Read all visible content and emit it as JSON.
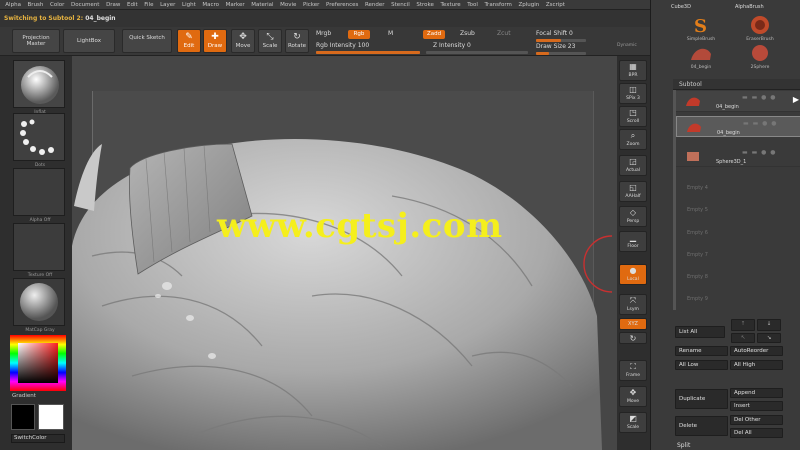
{
  "menu": [
    "Alpha",
    "Brush",
    "Color",
    "Document",
    "Draw",
    "Edit",
    "File",
    "Layer",
    "Light",
    "Macro",
    "Marker",
    "Material",
    "Movie",
    "Picker",
    "Preferences",
    "Render",
    "Stencil",
    "Stroke",
    "Texture",
    "Tool",
    "Transform",
    "Zplugin",
    "Zscript"
  ],
  "status": {
    "prefix": "Switching to Subtool 2:",
    "name": "04_begin"
  },
  "toolbar": {
    "projection_master": "Projection Master",
    "lightbox": "LightBox",
    "quick_sketch": "Quick Sketch",
    "edit": "Edit",
    "draw": "Draw",
    "move": "Move",
    "scale": "Scale",
    "rotate": "Rotate",
    "mrgb": "Mrgb",
    "rgb": "Rgb",
    "m": "M",
    "zadd": "Zadd",
    "zsub": "Zsub",
    "zcut": "Zcut",
    "rgb_intensity": "Rgb Intensity 100",
    "rgb_intensity_value": 1.0,
    "z_intensity": "Z Intensity 0",
    "z_intensity_value": 0.0,
    "focal_shift": "Focal Shift 0",
    "focal_shift_value": 0.5,
    "draw_size": "Draw Size 23",
    "draw_size_value": 0.25,
    "dynamic": "Dynamic"
  },
  "left": {
    "brush_label": "Inflat",
    "stroke_label": "Dots",
    "alpha_label": "Alpha Off",
    "texture_label": "Texture Off",
    "material_label": "MatCap Gray",
    "gradient_label": "Gradient",
    "switch_color": "SwitchColor"
  },
  "canvas": {
    "watermark": "www.cgtsj.com"
  },
  "right": [
    {
      "icon": "▦",
      "label": "BPR"
    },
    {
      "icon": "◫",
      "label": "SPix 3"
    },
    {
      "icon": "◳",
      "label": "Scroll"
    },
    {
      "icon": "⌕",
      "label": "Zoom"
    },
    {
      "icon": "◲",
      "label": "Actual"
    },
    {
      "icon": "◱",
      "label": "AAHalf"
    },
    {
      "icon": "◇",
      "label": "Persp"
    },
    {
      "icon": "▁",
      "label": "Floor"
    },
    {
      "icon": "●",
      "label": "Local"
    },
    {
      "icon": "⤧",
      "label": "Lsym"
    },
    {
      "icon": "XYZ",
      "label": ""
    },
    {
      "icon": "↻",
      "label": ""
    },
    {
      "icon": "⛶",
      "label": "Frame"
    },
    {
      "icon": "✥",
      "label": "Move"
    },
    {
      "icon": "◩",
      "label": "Scale"
    }
  ],
  "palette": {
    "top_label": "Cube3D",
    "top_label2": "AlphaBrush",
    "brushes": [
      "SimpleBrush",
      "EraserBrush",
      "04_begin",
      "Cylinder3D",
      "2Sphere"
    ],
    "subtool_title": "Subtool",
    "subtools": [
      {
        "name": "04_begin"
      },
      {
        "name": "04_begin"
      },
      {
        "name": "Sphere3D_1"
      }
    ],
    "empty": [
      "Empty 4",
      "Empty 5",
      "Empty 6",
      "Empty 7",
      "Empty 8",
      "Empty 9"
    ],
    "list_all": "List All",
    "rename": "Rename",
    "auto_reorder": "AutoReorder",
    "all_low": "All Low",
    "all_high": "All High",
    "duplicate": "Duplicate",
    "append": "Append",
    "insert": "Insert",
    "delete": "Delete",
    "del_other": "Del Other",
    "del_all": "Del All",
    "split": "Split"
  },
  "colors": {
    "accent": "#e06a10",
    "watermark": "#f5ef1c",
    "background": "#2b2b2b"
  }
}
